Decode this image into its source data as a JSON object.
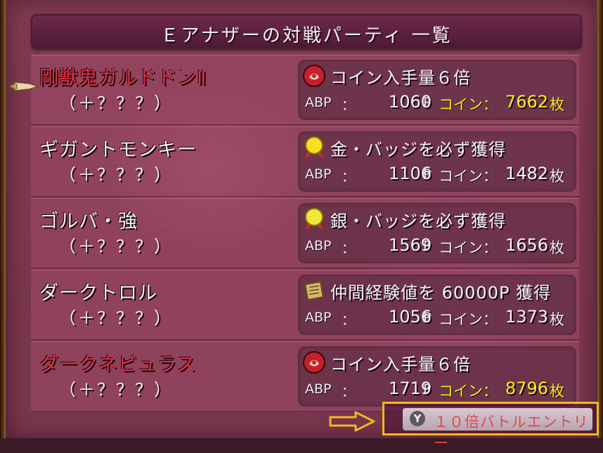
{
  "title": "Ｅアナザーの対戦パーティ 一覧",
  "labels": {
    "abp": "ABP",
    "colon": "：",
    "point_unit": "P",
    "coin": "コイン：",
    "coin_unit": "枚"
  },
  "rows": [
    {
      "name": "剛獣鬼ガルドドンⅡ",
      "name_color": "red",
      "sub": "（＋？？？）",
      "reward_icon": "red-coin-pot-icon",
      "reward": "コイン入手量６倍",
      "abp": "1060",
      "coins": "7662",
      "coin_highlight": true
    },
    {
      "name": "ギガントモンキー",
      "name_color": "white",
      "sub": "（＋？？？）",
      "reward_icon": "gold-badge-icon",
      "reward": "金・バッジを必ず獲得",
      "abp": "1106",
      "coins": "1482",
      "coin_highlight": false
    },
    {
      "name": "ゴルバ・強",
      "name_color": "white",
      "sub": "（＋？？？）",
      "reward_icon": "silver-badge-icon",
      "reward": "銀・バッジを必ず獲得",
      "abp": "1569",
      "coins": "1656",
      "coin_highlight": false
    },
    {
      "name": "ダークトロル",
      "name_color": "white",
      "sub": "（＋？？？）",
      "reward_icon": "scroll-icon",
      "reward": "仲間経験値を 60000P 獲得",
      "abp": "1056",
      "coins": "1373",
      "coin_highlight": false
    },
    {
      "name": "ダークネビュラス",
      "name_color": "red",
      "sub": "（＋？？？）",
      "reward_icon": "red-coin-pot-icon",
      "reward": "コイン入手量６倍",
      "abp": "1719",
      "coins": "8796",
      "coin_highlight": true
    }
  ],
  "footer": {
    "button": "Y",
    "entry": "１０倍バトルエントリー"
  },
  "colors": {
    "highlight_yellow": "#f4ee20",
    "name_red": "#e0323e",
    "annotation_orange": "#f2b81c"
  }
}
